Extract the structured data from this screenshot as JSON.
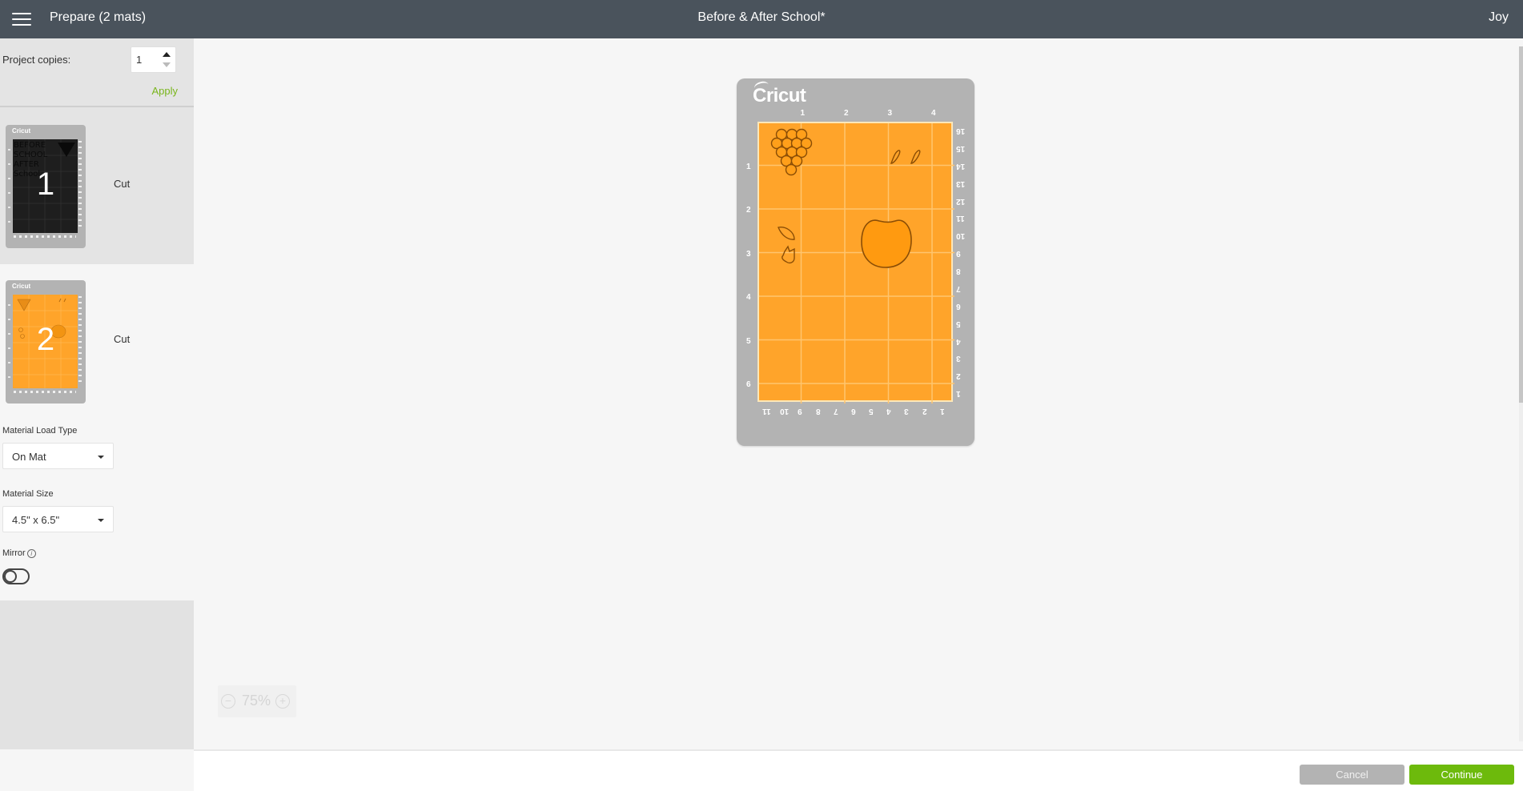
{
  "header": {
    "menu_icon": "hamburger-menu-icon",
    "title": "Prepare (2 mats)",
    "project_name": "Before & After School*",
    "user_name": "Joy"
  },
  "sidebar": {
    "project_copies": {
      "label": "Project copies:",
      "value": "1",
      "apply_label": "Apply"
    },
    "mats": [
      {
        "number": "1",
        "action": "Cut",
        "brand": "Cricut",
        "color": "#1e1e1e",
        "selected": true
      },
      {
        "number": "2",
        "action": "Cut",
        "brand": "Cricut",
        "color": "#ffa42a",
        "selected": false
      }
    ],
    "material_load_type": {
      "label": "Material Load Type",
      "value": "On Mat"
    },
    "material_size": {
      "label": "Material Size",
      "value": "4.5\" x 6.5\""
    },
    "mirror": {
      "label": "Mirror",
      "info_icon": "i",
      "enabled": false
    }
  },
  "canvas": {
    "mat": {
      "brand": "Cricut",
      "color": "#ffa42a",
      "top_ruler": [
        "1",
        "2",
        "3",
        "4"
      ],
      "left_ruler": [
        "1",
        "2",
        "3",
        "4",
        "5",
        "6"
      ],
      "right_ruler": [
        "16",
        "15",
        "14",
        "13",
        "12",
        "11",
        "10",
        "9",
        "8",
        "7",
        "6",
        "5",
        "4",
        "3",
        "2",
        "1"
      ],
      "bottom_ruler": [
        "11",
        "10",
        "9",
        "8",
        "7",
        "6",
        "5",
        "4",
        "3",
        "2",
        "1"
      ],
      "shapes": [
        "grape-cluster",
        "stem-1",
        "stem-2",
        "leaf",
        "tulip-flower",
        "apple"
      ]
    },
    "zoom": {
      "value": "75%",
      "minus": "−",
      "plus": "+"
    }
  },
  "footer": {
    "cancel_label": "Cancel",
    "continue_label": "Continue"
  },
  "colors": {
    "header_bg": "#4a535c",
    "accent_green": "#6dba0c",
    "apply_green": "#79b51c",
    "mat_grey": "#b3b3b3",
    "mat_orange": "#ffa42a"
  }
}
